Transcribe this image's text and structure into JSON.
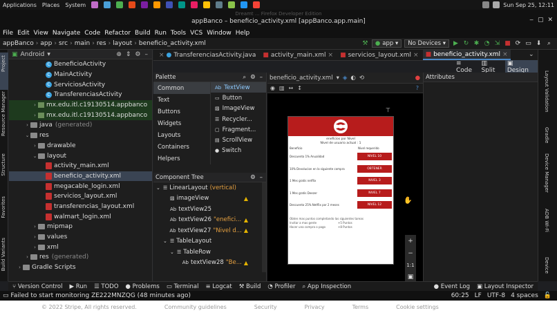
{
  "system_bar": {
    "applications": "Applications",
    "places": "Places",
    "system": "System",
    "datetime": "Sun Sep 25, 12:11"
  },
  "window": {
    "title": "appBanco – beneficio_activity.xml [appBanco.app.main]",
    "behind_title": "Dreamt ... Firefox Developer Edition"
  },
  "menu": [
    "File",
    "Edit",
    "View",
    "Navigate",
    "Code",
    "Refactor",
    "Build",
    "Run",
    "Tools",
    "VCS",
    "Window",
    "Help"
  ],
  "breadcrumb": [
    "appBanco",
    "app",
    "src",
    "main",
    "res",
    "layout",
    "beneficio_activity.xml"
  ],
  "toolbar": {
    "run_config": "app",
    "device": "No Devices"
  },
  "project": {
    "view_label": "Android",
    "items": [
      {
        "label": "BeneficioActivity",
        "type": "class",
        "indent": 4
      },
      {
        "label": "MainActivity",
        "type": "class",
        "indent": 4
      },
      {
        "label": "ServiciosActivity",
        "type": "class",
        "indent": 4
      },
      {
        "label": "TransferenciasActivity",
        "type": "class",
        "indent": 4
      },
      {
        "label": "mx.edu.itl.c19130514.appbanco",
        "type": "pkg",
        "indent": 3,
        "arrow": "›",
        "hl": true
      },
      {
        "label": "mx.edu.itl.c19130514.appbanco",
        "type": "pkg",
        "indent": 3,
        "arrow": "›",
        "hl": true
      },
      {
        "label": "java",
        "type": "folder",
        "indent": 2,
        "arrow": "›",
        "suffix": "(generated)"
      },
      {
        "label": "res",
        "type": "folder",
        "indent": 2,
        "arrow": "⌄"
      },
      {
        "label": "drawable",
        "type": "folder",
        "indent": 3,
        "arrow": "›"
      },
      {
        "label": "layout",
        "type": "folder",
        "indent": 3,
        "arrow": "⌄"
      },
      {
        "label": "activity_main.xml",
        "type": "xml",
        "indent": 4
      },
      {
        "label": "beneficio_activity.xml",
        "type": "xml",
        "indent": 4,
        "selected": true
      },
      {
        "label": "megacable_login.xml",
        "type": "xml",
        "indent": 4
      },
      {
        "label": "servicios_layout.xml",
        "type": "xml",
        "indent": 4
      },
      {
        "label": "transferencias_layout.xml",
        "type": "xml",
        "indent": 4
      },
      {
        "label": "walmart_login.xml",
        "type": "xml",
        "indent": 4
      },
      {
        "label": "mipmap",
        "type": "folder",
        "indent": 3,
        "arrow": "›"
      },
      {
        "label": "values",
        "type": "folder",
        "indent": 3,
        "arrow": "›"
      },
      {
        "label": "xml",
        "type": "folder",
        "indent": 3,
        "arrow": "›"
      },
      {
        "label": "res",
        "type": "folder",
        "indent": 2,
        "arrow": "›",
        "suffix": "(generated)"
      },
      {
        "label": "Gradle Scripts",
        "type": "folder",
        "indent": 1,
        "arrow": "›"
      }
    ]
  },
  "left_strip": [
    "Project",
    "Resource Manager",
    "Structure",
    "Favorites",
    "Build Variants"
  ],
  "right_strip": [
    "Layout Validation",
    "Gradle",
    "Device Manager",
    "ADB Wi-Fi",
    "Device"
  ],
  "editor_tabs": [
    {
      "label": "TransferenciasActivity.java",
      "active": false
    },
    {
      "label": "activity_main.xml",
      "active": false
    },
    {
      "label": "servicios_layout.xml",
      "active": false
    },
    {
      "label": "beneficio_activity.xml",
      "active": true
    }
  ],
  "view_modes": [
    "Code",
    "Split",
    "Design"
  ],
  "palette": {
    "title": "Palette",
    "categories": [
      "Common",
      "Text",
      "Buttons",
      "Widgets",
      "Layouts",
      "Containers",
      "Helpers"
    ],
    "items": [
      "TextView",
      "Button",
      "ImageView",
      "Recycler...",
      "Fragment...",
      "ScrollView",
      "Switch"
    ]
  },
  "component_tree": {
    "title": "Component Tree",
    "rows": [
      {
        "label": "LinearLayout",
        "suffix": "(vertical)",
        "indent": 0,
        "arrow": "⌄",
        "warn": false
      },
      {
        "label": "imageView",
        "suffix": "",
        "indent": 1,
        "warn": true
      },
      {
        "label": "textView25",
        "suffix": "",
        "indent": 1,
        "warn": false
      },
      {
        "label": "textView26",
        "suffix": "\"enefici...",
        "indent": 1,
        "warn": true
      },
      {
        "label": "textView27",
        "suffix": "\"Nivel d...",
        "indent": 1,
        "warn": true
      },
      {
        "label": "TableLayout",
        "suffix": "",
        "indent": 1,
        "arrow": "⌄",
        "warn": false
      },
      {
        "label": "TableRow",
        "suffix": "",
        "indent": 2,
        "arrow": "⌄",
        "warn": false
      },
      {
        "label": "textView28",
        "suffix": "\"Be...",
        "indent": 3,
        "warn": true
      }
    ]
  },
  "designer": {
    "file_label": "beneficio_activity.xml",
    "phone": {
      "subtitle1": "eneficios por Nivel",
      "subtitle2": "Nivel de usuario actual : 1",
      "col1": "Beneficio",
      "col2": "Nivel requerido",
      "rows": [
        {
          "label": "Descuento 1% Anualidad",
          "button": "NIVEL 10"
        },
        {
          "label": "10% Devolucion en la siguiente compra",
          "button": "OBTENER"
        },
        {
          "label": "1 Mes gratis netflix",
          "button": "NIVEL 3"
        },
        {
          "label": "1 Mes gratis Deezer",
          "button": "NIVEL 7"
        },
        {
          "label": "Descuento 25% Netflix por 2 meses",
          "button": "NIVEL 12"
        }
      ],
      "footer1": "Obten mas puntos completando las siguientes tareas",
      "footer2": "Invitar a mas gente",
      "footer2b": "+5 Puntos",
      "footer3": "Hacer una compra o pago",
      "footer3b": "+8 Puntos"
    },
    "zoom_label": "1:1"
  },
  "attributes": {
    "title": "Attributes"
  },
  "bottom_tools": [
    "Version Control",
    "Run",
    "TODO",
    "Problems",
    "Terminal",
    "Logcat",
    "Build",
    "Profiler",
    "App Inspection",
    "Event Log",
    "Layout Inspector"
  ],
  "status": {
    "message": "Failed to start monitoring ZE222MNZQG (48 minutes ago)",
    "position": "60:25",
    "line_sep": "LF",
    "encoding": "UTF-8",
    "indent": "4 spaces"
  },
  "behind_page": [
    "© 2022 Stripe, All rights reserved.",
    "Community guidelines",
    "Security",
    "Privacy",
    "Terms",
    "Cookie settings"
  ],
  "colors": {
    "accent": "#4a88c7",
    "brand_red": "#b71c1c",
    "warning": "#e5b400"
  }
}
